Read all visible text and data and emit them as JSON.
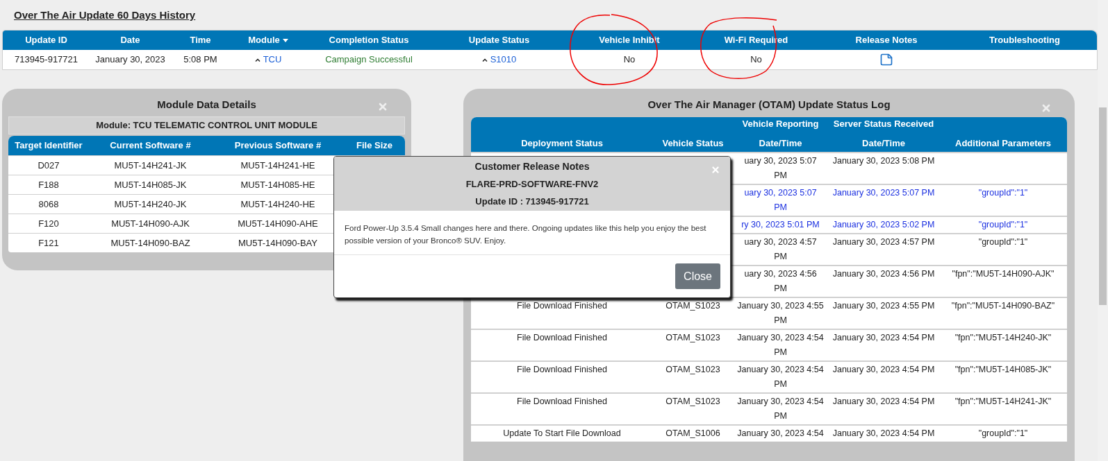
{
  "page_title": "Over The Air Update 60 Days History",
  "history": {
    "columns": [
      {
        "label": "Update ID"
      },
      {
        "label": "Date"
      },
      {
        "label": "Time"
      },
      {
        "label": "Module",
        "sorted": true
      },
      {
        "label": "Completion Status"
      },
      {
        "label": "Update Status"
      },
      {
        "label": "Vehicle Inhibit"
      },
      {
        "label": "Wi-Fi Required"
      },
      {
        "label": "Release Notes"
      },
      {
        "label": "Troubleshooting"
      }
    ],
    "rows": [
      {
        "cells": [
          {
            "kind": "text",
            "text": "713945-917721"
          },
          {
            "kind": "text",
            "text": "January 30, 2023"
          },
          {
            "kind": "text",
            "text": "5:08 PM"
          },
          {
            "kind": "link",
            "text": "TCU"
          },
          {
            "kind": "success",
            "text": "Campaign Successful"
          },
          {
            "kind": "link",
            "text": "S1010"
          },
          {
            "kind": "text",
            "text": "No"
          },
          {
            "kind": "text",
            "text": "No"
          },
          {
            "kind": "notes"
          }
        ]
      }
    ]
  },
  "module_panel": {
    "title": "Module Data Details",
    "module_label": "Module: TCU TELEMATIC CONTROL UNIT MODULE",
    "columns": [
      "Target Identifier",
      "Current Software #",
      "Previous Software #",
      "File Size"
    ],
    "rows": [
      [
        "D027",
        "MU5T-14H241-JK",
        "MU5T-14H241-HE"
      ],
      [
        "F188",
        "MU5T-14H085-JK",
        "MU5T-14H085-HE"
      ],
      [
        "8068",
        "MU5T-14H240-JK",
        "MU5T-14H240-HE"
      ],
      [
        "F120",
        "MU5T-14H090-AJK",
        "MU5T-14H090-AHE"
      ],
      [
        "F121",
        "MU5T-14H090-BAZ",
        "MU5T-14H090-BAY"
      ]
    ]
  },
  "log_panel": {
    "title": "Over The Air Manager (OTAM) Update Status Log",
    "columns": [
      {
        "bottom": "Deployment Status"
      },
      {
        "bottom": "Vehicle Status"
      },
      {
        "top": "Vehicle Reporting",
        "bottom": "Date/Time"
      },
      {
        "top": "Server Status Received",
        "bottom": "Date/Time"
      },
      {
        "bottom": "Additional Parameters"
      }
    ],
    "rows": [
      {
        "highlight": false,
        "vehicle_reporting": "uary 30, 2023 5:07 PM",
        "server_received": "January 30, 2023 5:08 PM"
      },
      {
        "highlight": true,
        "vehicle_reporting": "uary 30, 2023 5:07 PM",
        "server_received": "January 30, 2023 5:07 PM",
        "additional_parameters": "\"groupId\":\"1\""
      },
      {
        "highlight": true,
        "vehicle_reporting": "ry 30, 2023 5:01 PM",
        "server_received": "January 30, 2023 5:02 PM",
        "additional_parameters": "\"groupId\":\"1\""
      },
      {
        "highlight": false,
        "vehicle_reporting": "uary 30, 2023 4:57 PM",
        "server_received": "January 30, 2023 4:57 PM",
        "additional_parameters": "\"groupId\":\"1\""
      },
      {
        "highlight": false,
        "vehicle_reporting": "uary 30, 2023 4:56 PM",
        "server_received": "January 30, 2023 4:56 PM",
        "additional_parameters": "\"fpn\":\"MU5T-14H090-AJK\""
      },
      {
        "highlight": false,
        "deployment_status": "File Download Finished",
        "vehicle_status": "OTAM_S1023",
        "vehicle_reporting": "January 30, 2023 4:55 PM",
        "server_received": "January 30, 2023 4:55 PM",
        "additional_parameters": "\"fpn\":\"MU5T-14H090-BAZ\""
      },
      {
        "highlight": false,
        "deployment_status": "File Download Finished",
        "vehicle_status": "OTAM_S1023",
        "vehicle_reporting": "January 30, 2023 4:54 PM",
        "server_received": "January 30, 2023 4:54 PM",
        "additional_parameters": "\"fpn\":\"MU5T-14H240-JK\""
      },
      {
        "highlight": false,
        "deployment_status": "File Download Finished",
        "vehicle_status": "OTAM_S1023",
        "vehicle_reporting": "January 30, 2023 4:54 PM",
        "server_received": "January 30, 2023 4:54 PM",
        "additional_parameters": "\"fpn\":\"MU5T-14H085-JK\""
      },
      {
        "highlight": false,
        "deployment_status": "File Download Finished",
        "vehicle_status": "OTAM_S1023",
        "vehicle_reporting": "January 30, 2023 4:54 PM",
        "server_received": "January 30, 2023 4:54 PM",
        "additional_parameters": "\"fpn\":\"MU5T-14H241-JK\""
      },
      {
        "highlight": false,
        "deployment_status": "Update To Start File Download",
        "vehicle_status": "OTAM_S1006",
        "vehicle_reporting": "January 30, 2023 4:54",
        "server_received": "January 30, 2023 4:54 PM",
        "additional_parameters": "\"groupId\":\"1\""
      }
    ]
  },
  "modal": {
    "title": "Customer Release Notes",
    "subtitle": "FLARE-PRD-SOFTWARE-FNV2",
    "update_id": "Update ID : 713945-917721",
    "body": "Ford Power-Up 3.5.4 Small changes here and there. Ongoing updates like this help you enjoy the best possible version of your Bronco® SUV. Enjoy.",
    "close_button": "Close"
  }
}
